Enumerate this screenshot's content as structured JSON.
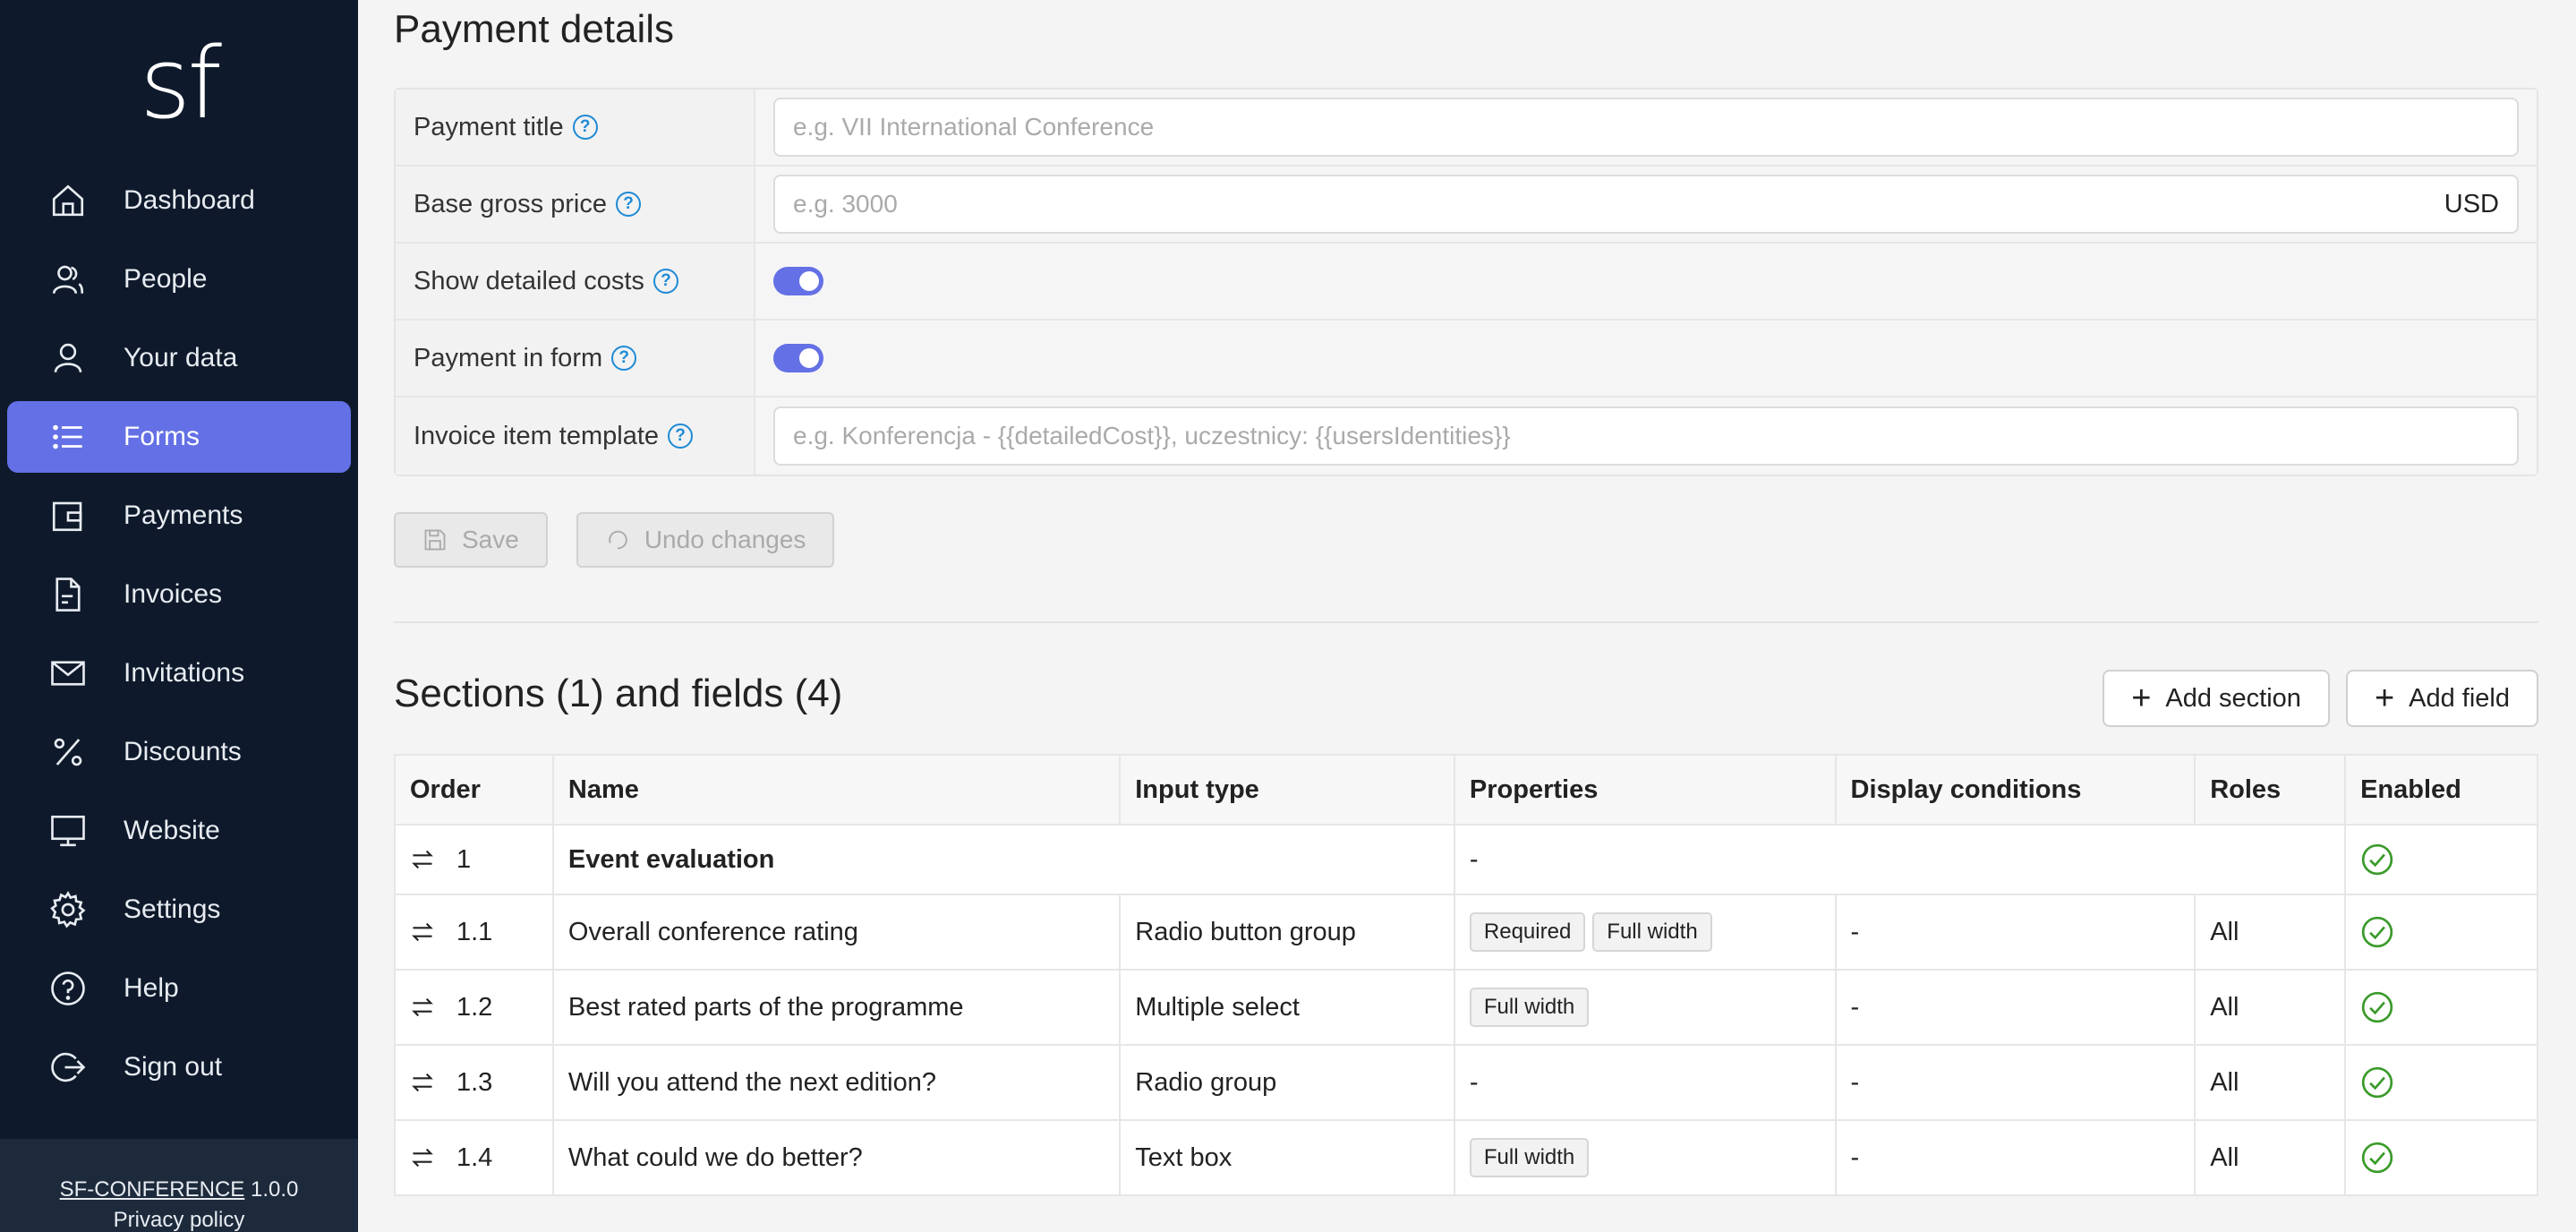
{
  "sidebar": {
    "logo": "sf",
    "items": [
      {
        "label": "Dashboard",
        "icon": "home-icon"
      },
      {
        "label": "People",
        "icon": "people-icon"
      },
      {
        "label": "Your data",
        "icon": "user-icon"
      },
      {
        "label": "Forms",
        "icon": "list-icon"
      },
      {
        "label": "Payments",
        "icon": "wallet-icon"
      },
      {
        "label": "Invoices",
        "icon": "document-icon"
      },
      {
        "label": "Invitations",
        "icon": "mail-icon"
      },
      {
        "label": "Discounts",
        "icon": "percent-icon"
      },
      {
        "label": "Website",
        "icon": "monitor-icon"
      },
      {
        "label": "Settings",
        "icon": "gear-icon"
      },
      {
        "label": "Help",
        "icon": "help-icon"
      },
      {
        "label": "Sign out",
        "icon": "sign-out-icon"
      }
    ],
    "footer": {
      "app_link": "SF-CONFERENCE",
      "version": "1.0.0",
      "privacy": "Privacy policy"
    }
  },
  "payment": {
    "title": "Payment details",
    "rows": {
      "payment_title": {
        "label": "Payment title",
        "placeholder": "e.g. VII International Conference"
      },
      "base_price": {
        "label": "Base gross price",
        "placeholder": "e.g. 3000",
        "unit": "USD"
      },
      "show_costs": {
        "label": "Show detailed costs",
        "enabled": true
      },
      "payment_in_form": {
        "label": "Payment in form",
        "enabled": true
      },
      "invoice_template": {
        "label": "Invoice item template",
        "placeholder": "e.g. Konferencja - {{detailedCost}}, uczestnicy: {{usersIdentities}}"
      }
    },
    "save_label": "Save",
    "undo_label": "Undo changes"
  },
  "sections": {
    "title": "Sections (1) and fields (4)",
    "add_section": "Add section",
    "add_field": "Add field",
    "columns": [
      "Order",
      "Name",
      "Input type",
      "Properties",
      "Display conditions",
      "Roles",
      "Enabled"
    ],
    "section_row": {
      "order": "1",
      "name": "Event evaluation",
      "properties": "-"
    },
    "fields": [
      {
        "order": "1.1",
        "name": "Overall conference rating",
        "input_type": "Radio button group",
        "properties": [
          "Required",
          "Full width"
        ],
        "conditions": "-",
        "roles": "All"
      },
      {
        "order": "1.2",
        "name": "Best rated parts of the programme",
        "input_type": "Multiple select",
        "properties": [
          "Full width"
        ],
        "conditions": "-",
        "roles": "All"
      },
      {
        "order": "1.3",
        "name": "Will you attend the next edition?",
        "input_type": "Radio group",
        "properties_text": "-",
        "conditions": "-",
        "roles": "All"
      },
      {
        "order": "1.4",
        "name": "What could we do better?",
        "input_type": "Text box",
        "properties": [
          "Full width"
        ],
        "conditions": "-",
        "roles": "All"
      }
    ]
  },
  "colors": {
    "sidebar_bg": "#0e1a2b",
    "accent": "#6470e5",
    "check": "#3a9a2a",
    "help": "#1f8ad6"
  }
}
